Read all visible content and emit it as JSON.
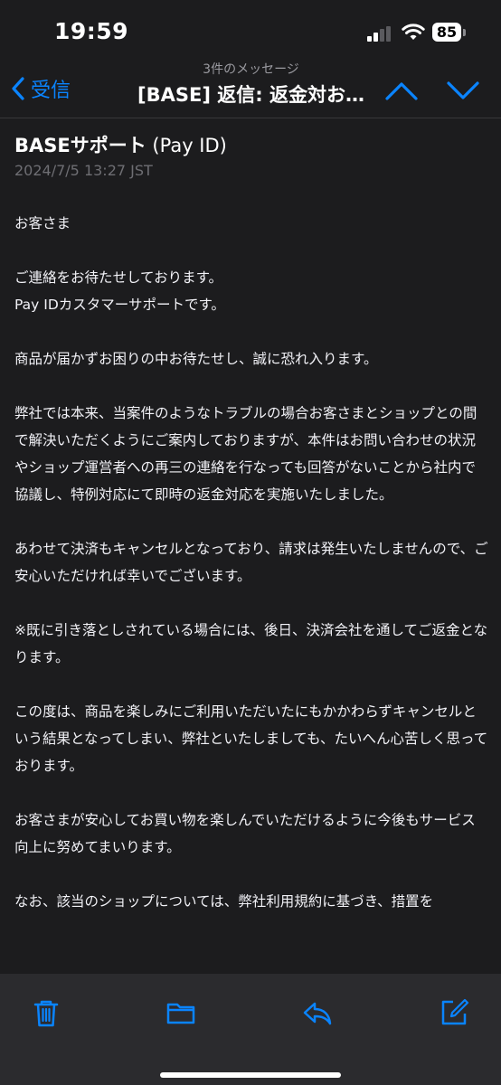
{
  "status_bar": {
    "time": "19:59",
    "battery": "85"
  },
  "nav": {
    "back_label": "受信",
    "subtitle": "3件のメッセージ",
    "title": "[BASE] 返信: 返金対お…"
  },
  "email": {
    "sender_name": "BASEサポート",
    "sender_sub": "(Pay ID)",
    "date": "2024/7/5 13:27 JST",
    "paragraphs": [
      "お客さま",
      "ご連絡をお待たせしております。\nPay IDカスタマーサポートです。",
      "商品が届かずお困りの中お待たせし、誠に恐れ入ります。",
      "弊社では本来、当案件のようなトラブルの場合お客さまとショップとの間で解決いただくようにご案内しておりますが、本件はお問い合わせの状況やショップ運営者への再三の連絡を行なっても回答がないことから社内で協議し、特例対応にて即時の返金対応を実施いたしました。",
      "あわせて決済もキャンセルとなっており、請求は発生いたしませんので、ご安心いただければ幸いでございます。",
      "※既に引き落としされている場合には、後日、決済会社を通してご返金となります。",
      "この度は、商品を楽しみにご利用いただいたにもかかわらずキャンセルという結果となってしまい、弊社といたしましても、たいへん心苦しく思っております。",
      "お客さまが安心してお買い物を楽しんでいただけるように今後もサービス向上に努めてまいります。",
      "なお、該当のショップについては、弊社利用規約に基づき、措置を"
    ]
  },
  "colors": {
    "accent": "#0a84ff",
    "background": "#1c1c1e",
    "toolbar": "#2b2b2e"
  },
  "toolbar_icons": [
    "trash-icon",
    "folder-icon",
    "reply-icon",
    "compose-icon"
  ]
}
